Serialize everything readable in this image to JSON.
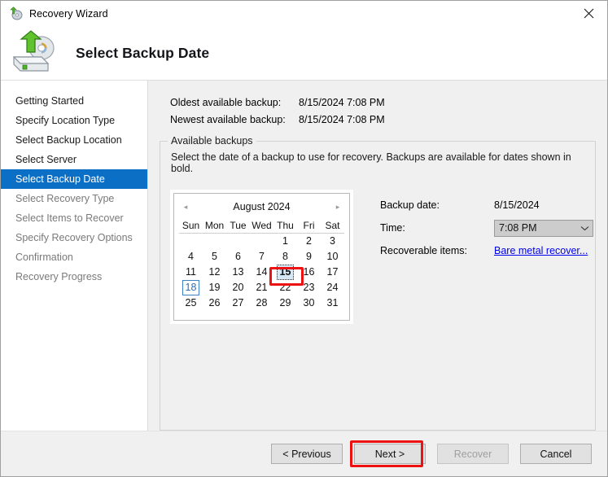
{
  "window": {
    "title": "Recovery Wizard",
    "title_icon": "recovery-disk-icon",
    "close_label": "✕"
  },
  "header": {
    "title": "Select Backup Date",
    "icon": "backup-disk-arrow-icon"
  },
  "sidebar": {
    "items": [
      {
        "label": "Getting Started",
        "state": "done"
      },
      {
        "label": "Specify Location Type",
        "state": "done"
      },
      {
        "label": "Select Backup Location",
        "state": "done"
      },
      {
        "label": "Select Server",
        "state": "done"
      },
      {
        "label": "Select Backup Date",
        "state": "selected"
      },
      {
        "label": "Select Recovery Type",
        "state": "pending"
      },
      {
        "label": "Select Items to Recover",
        "state": "pending"
      },
      {
        "label": "Specify Recovery Options",
        "state": "pending"
      },
      {
        "label": "Confirmation",
        "state": "pending"
      },
      {
        "label": "Recovery Progress",
        "state": "pending"
      }
    ],
    "selected_color": "#0c6fc6"
  },
  "info": {
    "oldest_label": "Oldest available backup:",
    "oldest_value": "8/15/2024 7:08 PM",
    "newest_label": "Newest available backup:",
    "newest_value": "8/15/2024 7:08 PM"
  },
  "group": {
    "legend": "Available backups",
    "description": "Select the date of a backup to use for recovery. Backups are available for dates shown in bold."
  },
  "calendar": {
    "month_title": "August 2024",
    "prev_arrow": "◂",
    "next_arrow": "▸",
    "weekdays": [
      "Sun",
      "Mon",
      "Tue",
      "Wed",
      "Thu",
      "Fri",
      "Sat"
    ],
    "leading_blanks": 4,
    "weeks": [
      [
        "",
        "",
        "",
        "",
        "1",
        "2",
        "3"
      ],
      [
        "4",
        "5",
        "6",
        "7",
        "8",
        "9",
        "10"
      ],
      [
        "11",
        "12",
        "13",
        "14",
        "15",
        "16",
        "17"
      ],
      [
        "18",
        "19",
        "20",
        "21",
        "22",
        "23",
        "24"
      ],
      [
        "25",
        "26",
        "27",
        "28",
        "29",
        "30",
        "31"
      ]
    ],
    "selected_day": "15",
    "today_day": "18",
    "backup_days": [
      "15"
    ]
  },
  "details": {
    "backup_date_label": "Backup date:",
    "backup_date_value": "8/15/2024",
    "time_label": "Time:",
    "time_value": "7:08 PM",
    "time_chevron": "chevron-down-icon",
    "recoverable_label": "Recoverable items:",
    "recoverable_link": "Bare metal recover..."
  },
  "footer": {
    "previous": "< Previous",
    "next": "Next >",
    "recover": "Recover",
    "cancel": "Cancel",
    "recover_disabled": true
  },
  "annotations": {
    "color": "#ee1111",
    "targets": [
      "calendar-day-15",
      "next-button"
    ]
  }
}
